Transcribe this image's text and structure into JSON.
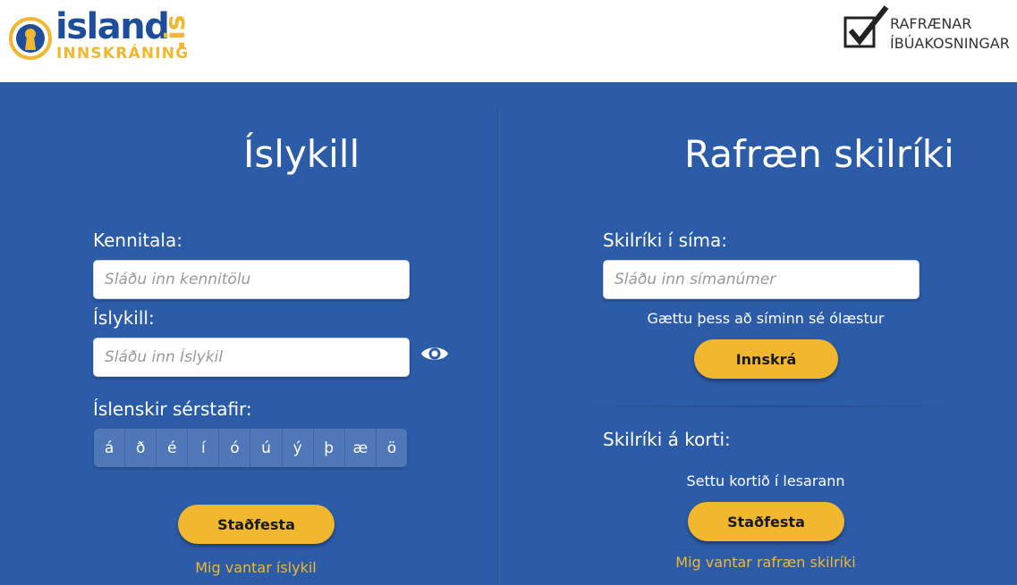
{
  "header": {
    "logo": {
      "word": "island",
      "domain": ".is",
      "sub": "INNSKRÁNING",
      "icon": "keyhole-icon"
    },
    "badge": {
      "line1": "RAFRÆNAR",
      "line2": "ÍBÚAKOSNINGAR",
      "icon": "checkbox-checked-icon"
    }
  },
  "islykill": {
    "title": "Íslykill",
    "kennitala_label": "Kennitala:",
    "kennitala_placeholder": "Sláðu inn kennitölu",
    "kennitala_value": "",
    "islykill_label": "Íslykill:",
    "islykill_placeholder": "Sláðu inn Íslykil",
    "islykill_value": "",
    "show_password_icon": "eye-icon",
    "special_chars_label": "Íslenskir sérstafir:",
    "special_chars": [
      "á",
      "ð",
      "é",
      "í",
      "ó",
      "ú",
      "ý",
      "þ",
      "æ",
      "ö"
    ],
    "submit_label": "Staðfesta",
    "missing_link": "Mig vantar íslykil"
  },
  "rafraen": {
    "title": "Rafræn skilríki",
    "phone_label": "Skilríki í síma:",
    "phone_placeholder": "Sláðu inn símanúmer",
    "phone_value": "",
    "phone_note": "Gættu þess að síminn sé ólæstur",
    "phone_submit_label": "Innskrá",
    "card_label": "Skilríki á korti:",
    "card_note": "Settu kortið í lesarann",
    "card_submit_label": "Staðfesta",
    "missing_link": "Mig vantar rafræn skilríki"
  },
  "colors": {
    "background": "#2c5ca8",
    "accent": "#f0b72f",
    "brand_blue": "#1e4d9b",
    "char_button": "#5077b8"
  }
}
